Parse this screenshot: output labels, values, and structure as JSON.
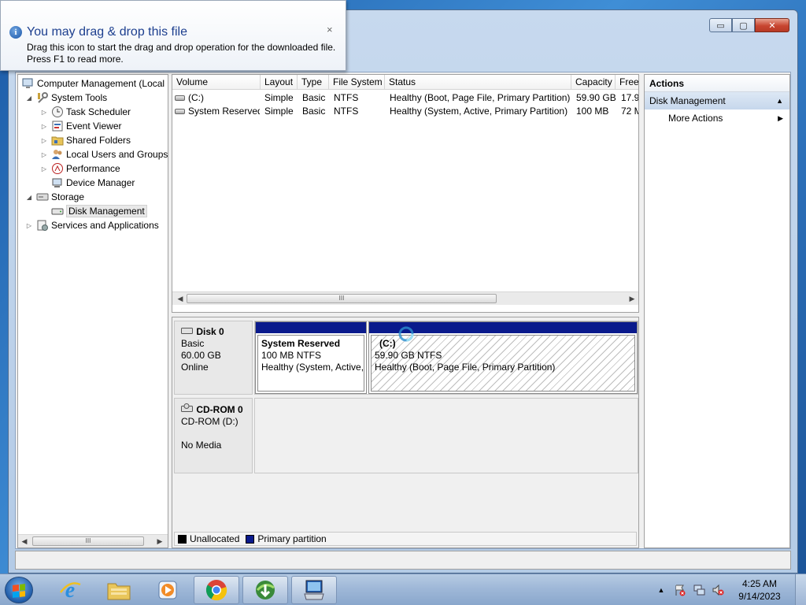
{
  "notification": {
    "title": "You may drag & drop this file",
    "text": "Drag this icon to start the drag and drop operation for the downloaded file. Press F1 to read more.",
    "icon": "info-icon",
    "close": "×"
  },
  "window": {
    "controls": {
      "minimize": "▭",
      "maximize": "▢",
      "close": "✕"
    }
  },
  "tree": {
    "items": [
      {
        "label": "Computer Management (Local",
        "icon": "computer-management-icon",
        "expander": ""
      },
      {
        "label": "System Tools",
        "icon": "system-tools-icon",
        "expander": "◢"
      },
      {
        "label": "Task Scheduler",
        "icon": "clock-icon",
        "expander": "▷"
      },
      {
        "label": "Event Viewer",
        "icon": "event-viewer-icon",
        "expander": "▷"
      },
      {
        "label": "Shared Folders",
        "icon": "shared-folder-icon",
        "expander": "▷"
      },
      {
        "label": "Local Users and Groups",
        "icon": "users-icon",
        "expander": "▷"
      },
      {
        "label": "Performance",
        "icon": "performance-icon",
        "expander": "▷"
      },
      {
        "label": "Device Manager",
        "icon": "device-manager-icon",
        "expander": ""
      },
      {
        "label": "Storage",
        "icon": "storage-icon",
        "expander": "◢"
      },
      {
        "label": "Disk Management",
        "icon": "disk-management-icon",
        "expander": ""
      },
      {
        "label": "Services and Applications",
        "icon": "services-icon",
        "expander": "▷"
      }
    ],
    "scroll_grip": "III"
  },
  "volumes": {
    "columns": [
      "Volume",
      "Layout",
      "Type",
      "File System",
      "Status",
      "Capacity",
      "Free"
    ],
    "rows": [
      {
        "volume": "(C:)",
        "layout": "Simple",
        "type": "Basic",
        "fs": "NTFS",
        "status": "Healthy (Boot, Page File, Primary Partition)",
        "capacity": "59.90 GB",
        "free": "17.9:"
      },
      {
        "volume": "System Reserved",
        "layout": "Simple",
        "type": "Basic",
        "fs": "NTFS",
        "status": "Healthy (System, Active, Primary Partition)",
        "capacity": "100 MB",
        "free": "72 M"
      }
    ],
    "scroll_grip": "III"
  },
  "disks": [
    {
      "name": "Disk 0",
      "kind": "Basic",
      "size": "60.00 GB",
      "state": "Online",
      "partitions": [
        {
          "name": "System Reserved",
          "size_fs": "100 MB NTFS",
          "status": "Healthy (System, Active,"
        },
        {
          "name": "(C:)",
          "size_fs": "59.90 GB NTFS",
          "status": "Healthy (Boot, Page File, Primary Partition)"
        }
      ]
    },
    {
      "name": "CD-ROM 0",
      "kind": "CD-ROM (D:)",
      "media": "No Media"
    }
  ],
  "legend": [
    {
      "label": "Unallocated",
      "color": "#000000"
    },
    {
      "label": "Primary partition",
      "color": "#0a1a8c"
    }
  ],
  "actions": {
    "header": "Actions",
    "section": "Disk Management",
    "section_chevron": "▲",
    "items": [
      {
        "label": "More Actions",
        "chevron": "▶"
      }
    ]
  },
  "taskbar": {
    "apps": [
      "internet-explorer-icon",
      "explorer-folder-icon",
      "media-player-icon",
      "chrome-icon",
      "download-manager-icon",
      "computer-management-icon"
    ],
    "tray_chevron": "▲",
    "time": "4:25 AM",
    "date": "9/14/2023"
  }
}
